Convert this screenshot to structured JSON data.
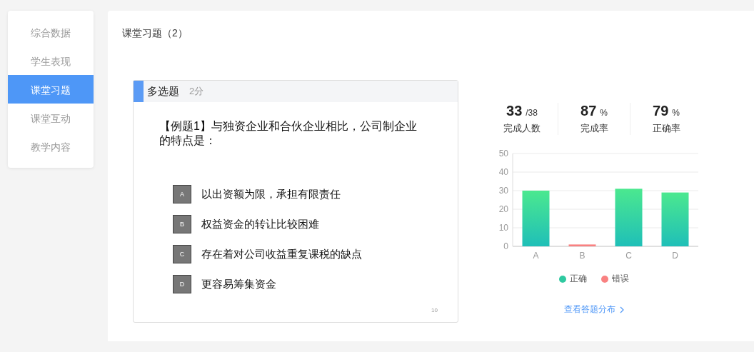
{
  "sidebar": {
    "items": [
      {
        "label": "综合数据",
        "selected": false
      },
      {
        "label": "学生表现",
        "selected": false
      },
      {
        "label": "课堂习题",
        "selected": true
      },
      {
        "label": "课堂互动",
        "selected": false
      },
      {
        "label": "教学内容",
        "selected": false
      }
    ]
  },
  "page_title": "课堂习题（2）",
  "question": {
    "type": "多选题",
    "score": "2分",
    "text": "【例题1】与独资企业和合伙企业相比，公司制企业的特点是：",
    "options": [
      {
        "letter": "A",
        "text": "以出资额为限，承担有限责任"
      },
      {
        "letter": "B",
        "text": "权益资金的转让比较困难"
      },
      {
        "letter": "C",
        "text": "存在着对公司收益重复课税的缺点"
      },
      {
        "letter": "D",
        "text": "更容易筹集资金"
      }
    ],
    "page_number": "10"
  },
  "stats": [
    {
      "value": "33",
      "unit": "/38",
      "label": "完成人数"
    },
    {
      "value": "87",
      "unit": "%",
      "label": "完成率"
    },
    {
      "value": "79",
      "unit": "%",
      "label": "正确率"
    }
  ],
  "chart_data": {
    "type": "bar",
    "categories": [
      "A",
      "B",
      "C",
      "D"
    ],
    "grid": true,
    "ylim": [
      0,
      50
    ],
    "yticks": [
      0,
      10,
      20,
      30,
      40,
      50
    ],
    "series": [
      {
        "name": "正确",
        "color": "#2ec9a0",
        "values": [
          30,
          null,
          31,
          29
        ]
      },
      {
        "name": "错误",
        "color": "#f98181",
        "values": [
          null,
          1,
          null,
          null
        ]
      }
    ]
  },
  "details_link": "查看答题分布"
}
